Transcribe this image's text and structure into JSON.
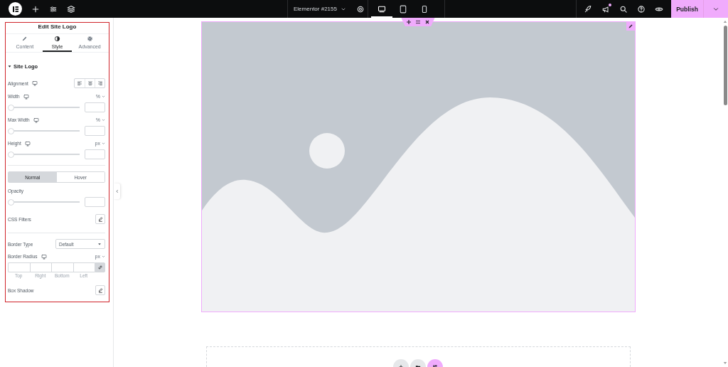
{
  "topbar": {
    "document_title": "Elementor #2155",
    "devices": [
      {
        "kind": "desktop",
        "selected": true
      },
      {
        "kind": "tablet",
        "selected": false
      },
      {
        "kind": "mobile",
        "selected": false
      }
    ],
    "notification": true,
    "publish": "Publish"
  },
  "panel": {
    "title": "Edit Site Logo",
    "tabs": [
      {
        "kind": "content",
        "label": "Content",
        "selected": false
      },
      {
        "kind": "style",
        "label": "Style",
        "selected": true
      },
      {
        "kind": "advanced",
        "label": "Advanced",
        "selected": false
      }
    ],
    "section": {
      "title": "Site Logo",
      "expanded": true
    },
    "controls": [
      {
        "kind": "alignment",
        "label": "Alignment",
        "responsive": true
      },
      {
        "kind": "slider",
        "label": "Width",
        "responsive": true,
        "unit": "%",
        "level": 0
      },
      {
        "kind": "slider",
        "label": "Max Width",
        "responsive": true,
        "unit": "%",
        "level": 0
      },
      {
        "kind": "slider",
        "label": "Height",
        "responsive": true,
        "unit": "px",
        "level": 0
      },
      {
        "kind": "divider"
      },
      {
        "kind": "state_tabs",
        "tabs": [
          {
            "label": "Normal",
            "selected": true
          },
          {
            "label": "Hover",
            "selected": false
          }
        ]
      },
      {
        "kind": "slider",
        "label": "Opacity",
        "responsive": false,
        "level": 0
      },
      {
        "kind": "popover",
        "label": "CSS Filters"
      },
      {
        "kind": "divider"
      },
      {
        "kind": "select",
        "label": "Border Type",
        "value": "Default"
      },
      {
        "kind": "dimensions",
        "label": "Border Radius",
        "responsive": true,
        "unit": "px",
        "sides": [
          "Top",
          "Right",
          "Bottom",
          "Left"
        ],
        "linked": true
      },
      {
        "kind": "popover",
        "label": "Box Shadow"
      }
    ]
  }
}
